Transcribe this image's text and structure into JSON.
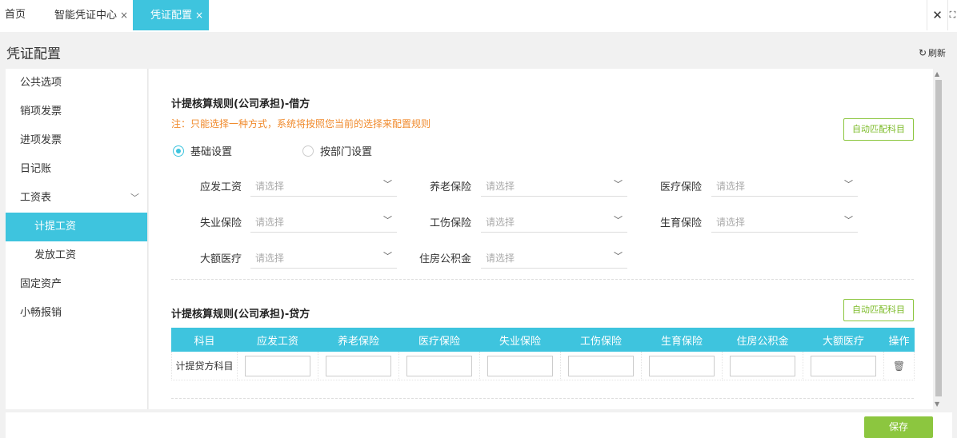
{
  "tabs": [
    {
      "label": "首页",
      "closable": false,
      "active": false
    },
    {
      "label": "智能凭证中心",
      "close": "×",
      "active": false
    },
    {
      "label": "凭证配置",
      "close": "×",
      "active": true
    }
  ],
  "window_controls": {
    "close": "✕",
    "expand": "⛶"
  },
  "page": {
    "title": "凭证配置",
    "refresh_label": "刷新",
    "refresh_icon": "↻"
  },
  "sidebar": {
    "items": [
      {
        "label": "公共选项"
      },
      {
        "label": "销项发票"
      },
      {
        "label": "进项发票"
      },
      {
        "label": "日记账"
      },
      {
        "label": "工资表",
        "expanded": true,
        "chevron": "﹀"
      },
      {
        "label": "计提工资",
        "active": true
      },
      {
        "label": "发放工资"
      },
      {
        "label": "固定资产"
      },
      {
        "label": "小畅报销"
      }
    ]
  },
  "debit": {
    "title": "计提核算规则(公司承担)-借方",
    "note": "注：只能选择一种方式，系统将按照您当前的选择来配置规则",
    "auto_match": "自动匹配科目",
    "radio_basic": "基础设置",
    "radio_dept": "按部门设置",
    "selected_mode": "基础设置",
    "placeholder": "请选择",
    "arrow": "﹀",
    "fields": [
      {
        "label": "应发工资"
      },
      {
        "label": "养老保险"
      },
      {
        "label": "医疗保险"
      },
      {
        "label": "失业保险"
      },
      {
        "label": "工伤保险"
      },
      {
        "label": "生育保险"
      },
      {
        "label": "大额医疗"
      },
      {
        "label": "住房公积金"
      }
    ]
  },
  "credit": {
    "title": "计提核算规则(公司承担)-贷方",
    "auto_match": "自动匹配科目",
    "columns": [
      "科目",
      "应发工资",
      "养老保险",
      "医疗保险",
      "失业保险",
      "工伤保险",
      "生育保险",
      "住房公积金",
      "大额医疗",
      "操作"
    ],
    "row_label": "计提贷方科目",
    "delete_icon": "🗑"
  },
  "footer": {
    "save_label": "保存"
  },
  "colors": {
    "accent": "#3ec4de",
    "green": "#8cc63f",
    "warning": "#f08a2c"
  }
}
